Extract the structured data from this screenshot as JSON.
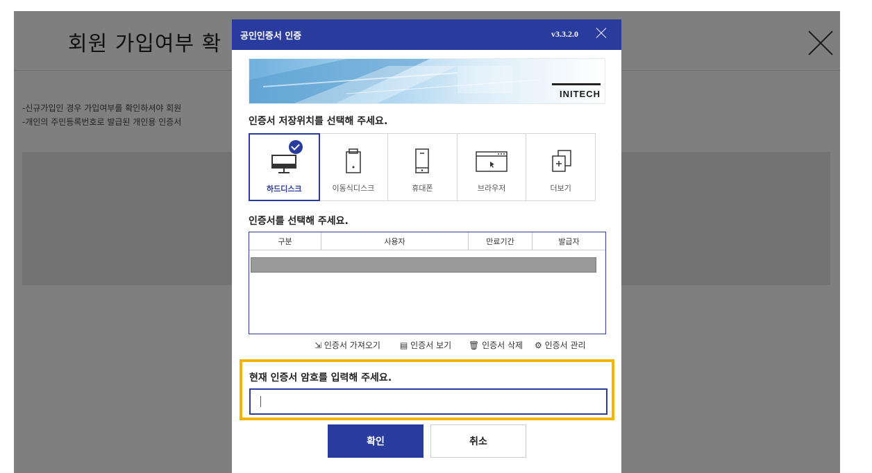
{
  "page": {
    "title": "회원 가입여부 확",
    "notice_lines": [
      "-신규가입인 경우 가입여부를 확인하셔야 회원",
      "-개인의 주민등록번호로 발급된 개인용 인증서"
    ]
  },
  "dialog": {
    "title": "공인인증서 인증",
    "version": "v3.3.2.0",
    "banner_logo": "INITECH",
    "location_prompt": "인증서 저장위치를 선택해 주세요.",
    "locations": [
      {
        "label": "하드디스크",
        "icon": "monitor-icon",
        "selected": true
      },
      {
        "label": "이동식디스크",
        "icon": "usb-drive-icon",
        "selected": false
      },
      {
        "label": "휴대폰",
        "icon": "phone-icon",
        "selected": false
      },
      {
        "label": "브라우저",
        "icon": "browser-icon",
        "selected": false
      },
      {
        "label": "더보기",
        "icon": "more-icon",
        "selected": false
      }
    ],
    "cert_prompt": "인증서를 선택해 주세요.",
    "table_headers": [
      "구분",
      "사용자",
      "만료기간",
      "발급자"
    ],
    "actions": [
      {
        "label": "인증서 가져오기",
        "icon": "import-icon"
      },
      {
        "label": "인증서 보기",
        "icon": "view-icon"
      },
      {
        "label": "인증서 삭제",
        "icon": "trash-icon"
      },
      {
        "label": "인증서 관리",
        "icon": "gear-icon"
      }
    ],
    "password_prompt": "현재 인증서 암호를 입력해 주세요.",
    "password_value": "",
    "ok_label": "확인",
    "cancel_label": "취소",
    "accent_color": "#2a3b9e",
    "highlight_color": "#f4b400"
  }
}
